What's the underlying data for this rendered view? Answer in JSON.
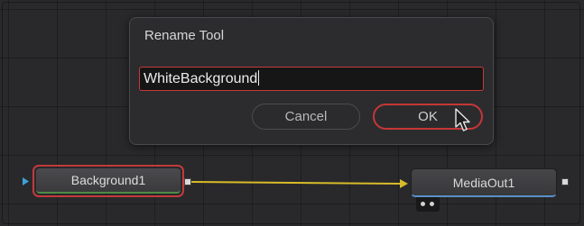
{
  "dialog": {
    "title": "Rename Tool",
    "name_value": "WhiteBackground",
    "cancel_label": "Cancel",
    "ok_label": "OK"
  },
  "nodes": {
    "background": {
      "label": "Background1"
    },
    "mediaout": {
      "label": "MediaOut1"
    }
  },
  "colors": {
    "accent_red": "#c63638",
    "connection_yellow": "#d8bb2a",
    "output_blue": "#5a90c9",
    "input_blue": "#3ea0d8",
    "background_green": "#4c8c46"
  }
}
